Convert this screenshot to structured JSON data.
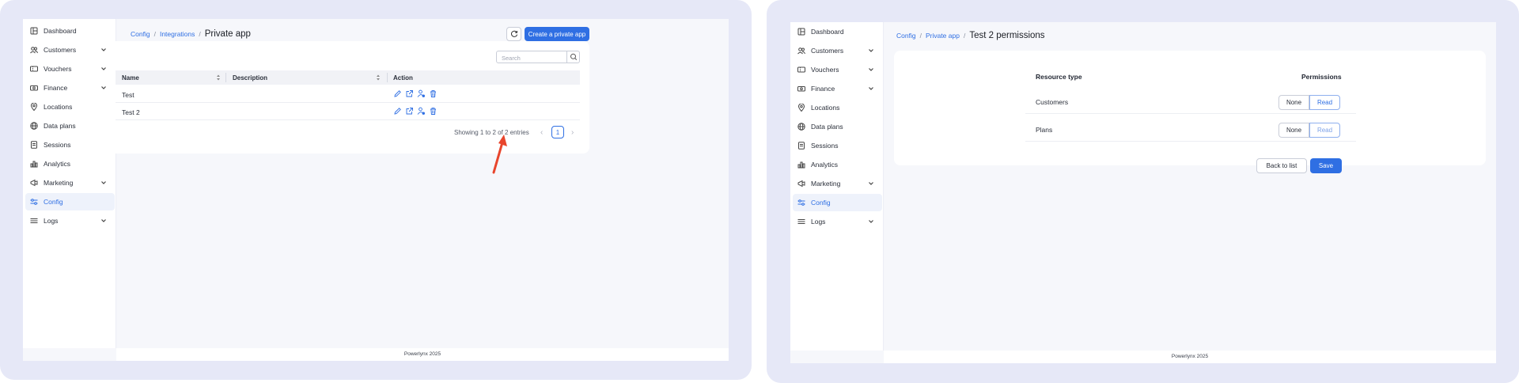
{
  "colors": {
    "accent": "#2f6fe3",
    "panel_bg": "#e6e8f7",
    "annotation_arrow": "#e8452c"
  },
  "sidebar": {
    "items": [
      {
        "label": "Dashboard",
        "icon": "dashboard-icon",
        "expandable": false
      },
      {
        "label": "Customers",
        "icon": "customers-icon",
        "expandable": true
      },
      {
        "label": "Vouchers",
        "icon": "voucher-icon",
        "expandable": true
      },
      {
        "label": "Finance",
        "icon": "finance-icon",
        "expandable": true
      },
      {
        "label": "Locations",
        "icon": "location-pin-icon",
        "expandable": false
      },
      {
        "label": "Data plans",
        "icon": "globe-icon",
        "expandable": false
      },
      {
        "label": "Sessions",
        "icon": "sessions-icon",
        "expandable": false
      },
      {
        "label": "Analytics",
        "icon": "analytics-icon",
        "expandable": false
      },
      {
        "label": "Marketing",
        "icon": "megaphone-icon",
        "expandable": true
      },
      {
        "label": "Config",
        "icon": "sliders-icon",
        "expandable": false,
        "active": true
      },
      {
        "label": "Logs",
        "icon": "list-icon",
        "expandable": true
      }
    ]
  },
  "footer": {
    "text": "Powerlynx 2025"
  },
  "left": {
    "breadcrumb": {
      "config": "Config",
      "integrations": "Integrations",
      "current": "Private app"
    },
    "create_button": "Create a private app",
    "search": {
      "placeholder": "Search"
    },
    "table": {
      "headers": {
        "name": "Name",
        "description": "Description",
        "action": "Action"
      },
      "rows": [
        {
          "name": "Test",
          "description": ""
        },
        {
          "name": "Test 2",
          "description": ""
        }
      ]
    },
    "pagination": {
      "info": "Showing 1 to 2 of 2 entries",
      "current_page": "1",
      "prev": "‹",
      "next": "›"
    }
  },
  "right": {
    "breadcrumb": {
      "config": "Config",
      "private_app": "Private app",
      "current": "Test 2 permissions"
    },
    "headers": {
      "resource": "Resource type",
      "permissions": "Permissions"
    },
    "rows": [
      {
        "resource": "Customers",
        "none": "None",
        "read": "Read"
      },
      {
        "resource": "Plans",
        "none": "None",
        "read": "Read"
      }
    ],
    "back_button": "Back to list",
    "save_button": "Save"
  }
}
